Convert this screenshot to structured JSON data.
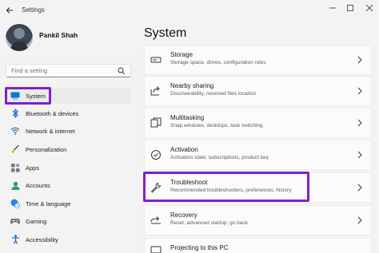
{
  "window": {
    "title": "Settings"
  },
  "profile": {
    "name": "Pankil Shah"
  },
  "search": {
    "placeholder": "Find a setting"
  },
  "sidebar": {
    "items": [
      {
        "label": "System",
        "icon": "laptop-icon"
      },
      {
        "label": "Bluetooth & devices",
        "icon": "bluetooth-icon"
      },
      {
        "label": "Network & internet",
        "icon": "wifi-icon"
      },
      {
        "label": "Personalization",
        "icon": "brush-icon"
      },
      {
        "label": "Apps",
        "icon": "apps-icon"
      },
      {
        "label": "Accounts",
        "icon": "person-icon"
      },
      {
        "label": "Time & language",
        "icon": "globe-clock-icon"
      },
      {
        "label": "Gaming",
        "icon": "gamepad-icon"
      },
      {
        "label": "Accessibility",
        "icon": "accessibility-icon"
      }
    ]
  },
  "main": {
    "title": "System",
    "cards": [
      {
        "title": "Storage",
        "subtitle": "Storage space, drives, configuration rules",
        "icon": "storage-icon"
      },
      {
        "title": "Nearby sharing",
        "subtitle": "Discoverability, received files location",
        "icon": "share-icon"
      },
      {
        "title": "Multitasking",
        "subtitle": "Snap windows, desktops, task switching",
        "icon": "multitasking-icon"
      },
      {
        "title": "Activation",
        "subtitle": "Activation state, subscriptions, product key",
        "icon": "check-circle-icon"
      },
      {
        "title": "Troubleshoot",
        "subtitle": "Recommended troubleshooters, preferences, history",
        "icon": "wrench-icon"
      },
      {
        "title": "Recovery",
        "subtitle": "Reset, advanced startup, go back",
        "icon": "recovery-icon"
      },
      {
        "title": "Projecting to this PC",
        "subtitle": "",
        "icon": "projector-icon"
      }
    ]
  },
  "colors": {
    "accent": "#0067c0",
    "highlight": "#7b22c7"
  }
}
